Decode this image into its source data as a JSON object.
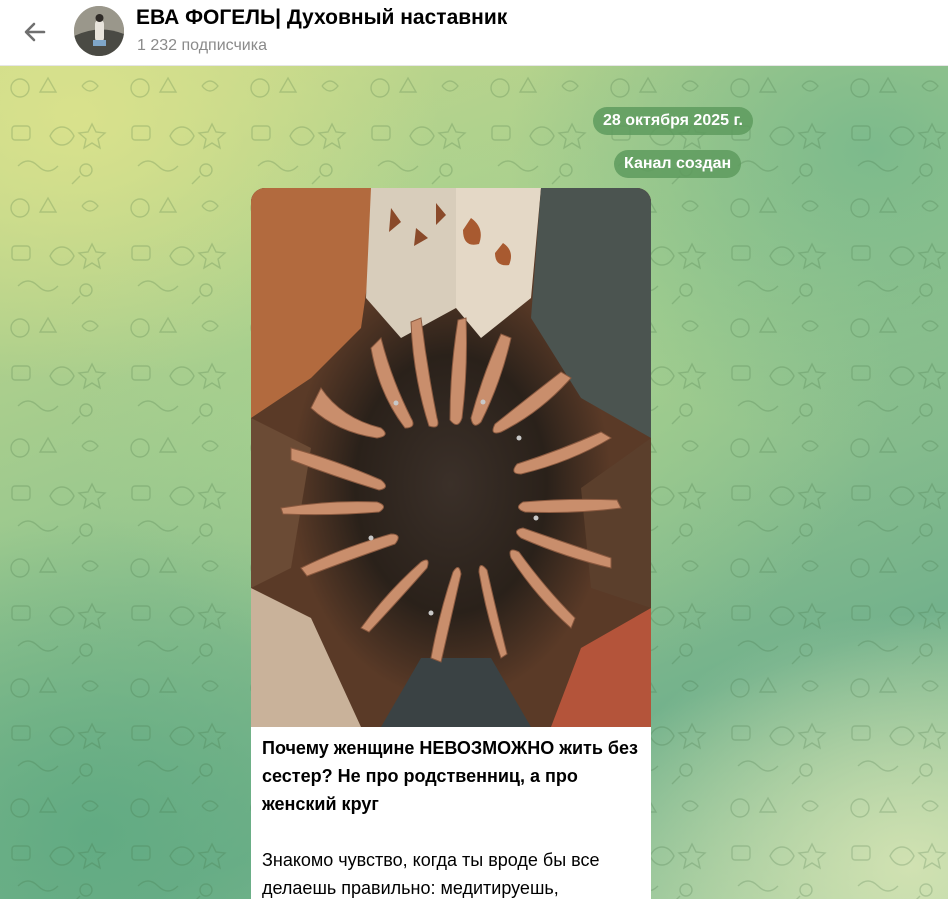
{
  "header": {
    "back_icon": "arrow-left-icon",
    "channel_title": "ЕВА ФОГЕЛЬ| Духовный наставник",
    "subscribers": "1 232 подписчика"
  },
  "chat": {
    "date_label": "28 октября 2025 г.",
    "service_message": "Канал создан",
    "post": {
      "title": "Почему женщине НЕВОЗМОЖНО жить без сестер? Не про родственниц, а про женский круг",
      "body": "Знакомо чувство, когда ты вроде бы все делаешь правильно: медитируешь,"
    }
  },
  "colors": {
    "accent_pill": "#5e9b5e",
    "header_bg": "#ffffff",
    "bubble_bg": "#ffffff"
  }
}
